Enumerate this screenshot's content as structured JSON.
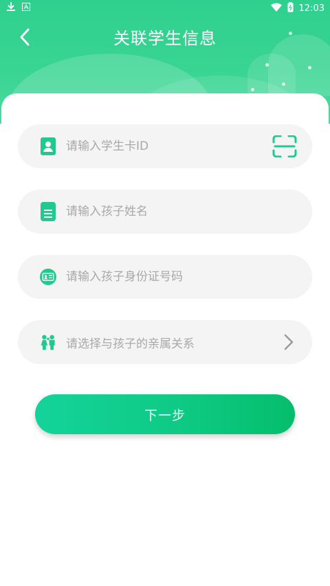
{
  "status_bar": {
    "time": "12:03"
  },
  "header": {
    "title": "关联学生信息"
  },
  "form": {
    "student_card": {
      "placeholder": "请输入学生卡ID"
    },
    "child_name": {
      "placeholder": "请输入孩子姓名"
    },
    "child_id_number": {
      "placeholder": "请输入孩子身份证号码"
    },
    "relationship": {
      "placeholder": "请选择与孩子的亲属关系"
    }
  },
  "actions": {
    "next_label": "下一步"
  },
  "colors": {
    "accent": "#22c98f",
    "header": "#38d492",
    "field_bg": "#f4f4f4",
    "placeholder": "#a8a8a8"
  },
  "icons": [
    "download-icon",
    "app-notify-icon",
    "wifi-icon",
    "battery-icon",
    "back-chevron-icon",
    "id-card-icon",
    "scan-icon",
    "document-icon",
    "id-badge-icon",
    "family-icon",
    "chevron-right-icon"
  ]
}
